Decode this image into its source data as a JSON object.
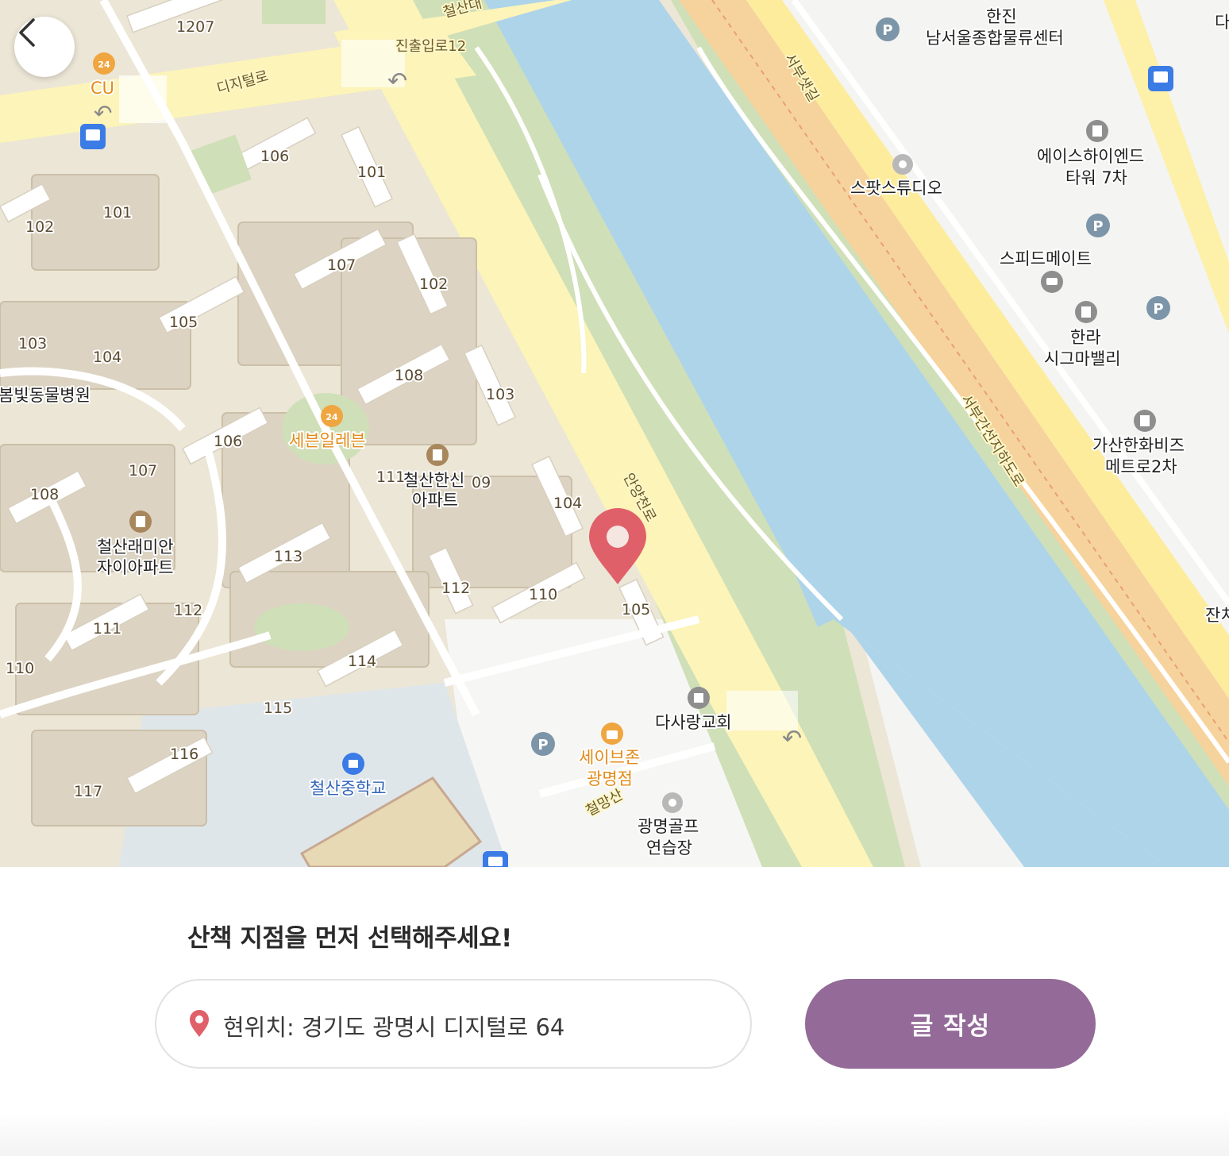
{
  "map": {
    "labels": {
      "n1207": "1207",
      "cu": "CU",
      "digital_ro": "디지털로",
      "jinchul12": "진출입로12",
      "cheolsan_top": "철산대",
      "anyangcheon_ro": "안양천로",
      "seobu_saet": "서부샛길",
      "seobu_underground": "서부간선지하도로",
      "n106a": "106",
      "n101a": "101",
      "n102a": "102",
      "n101b": "101",
      "n107a": "107",
      "n102b": "102",
      "n105a": "105",
      "n103a": "103",
      "n104a": "104",
      "n108a": "108",
      "n103b": "103",
      "bombit": "봄빛동물병원",
      "seven": "세븐일레븐",
      "n106b": "106",
      "n111a": "111",
      "cheolsan_hanshin": "철산한신",
      "n109": "09",
      "apt": "아파트",
      "n107b": "107",
      "n108b": "108",
      "n104b": "104",
      "raemian_1": "철산래미안",
      "raemian_2": "자이아파트",
      "n113": "113",
      "n112a": "112",
      "n110a": "110",
      "n105b": "105",
      "n112b": "112",
      "n111b": "111",
      "n110b": "110",
      "n114": "114",
      "n115": "115",
      "dasarang": "다사랑교회",
      "n116": "116",
      "n117": "117",
      "safezone_1": "세이브존",
      "safezone_2": "광명점",
      "cheolmang": "철망산",
      "middle_school": "철산중학교",
      "golf_1": "광명골프",
      "golf_2": "연습장",
      "hanjin_1": "한진",
      "hanjin_2": "남서울종합물류센터",
      "ace_1": "에이스하이엔드",
      "ace_2": "타워 7차",
      "spot": "스팟스튜디오",
      "speedmate": "스피드메이트",
      "halla_1": "한라",
      "halla_2": "시그마밸리",
      "gasan_1": "가산한화비즈",
      "gasan_2": "메트로2차",
      "jan": "잔치",
      "da": "다"
    }
  },
  "back_button": {
    "icon": "chevron-left-icon"
  },
  "panel": {
    "prompt": "산책 지점을 먼저 선택해주세요!",
    "location_text": "현위치: 경기도 광명시 디지털로 64",
    "location_icon": "location-pin-icon",
    "write_button": "글 작성"
  },
  "colors": {
    "accent": "#936a98",
    "pin": "#e0606a",
    "water": "#aed4ea",
    "highway": "#f6d39c",
    "road": "#fcf4b8",
    "park": "#cfdfb8"
  }
}
